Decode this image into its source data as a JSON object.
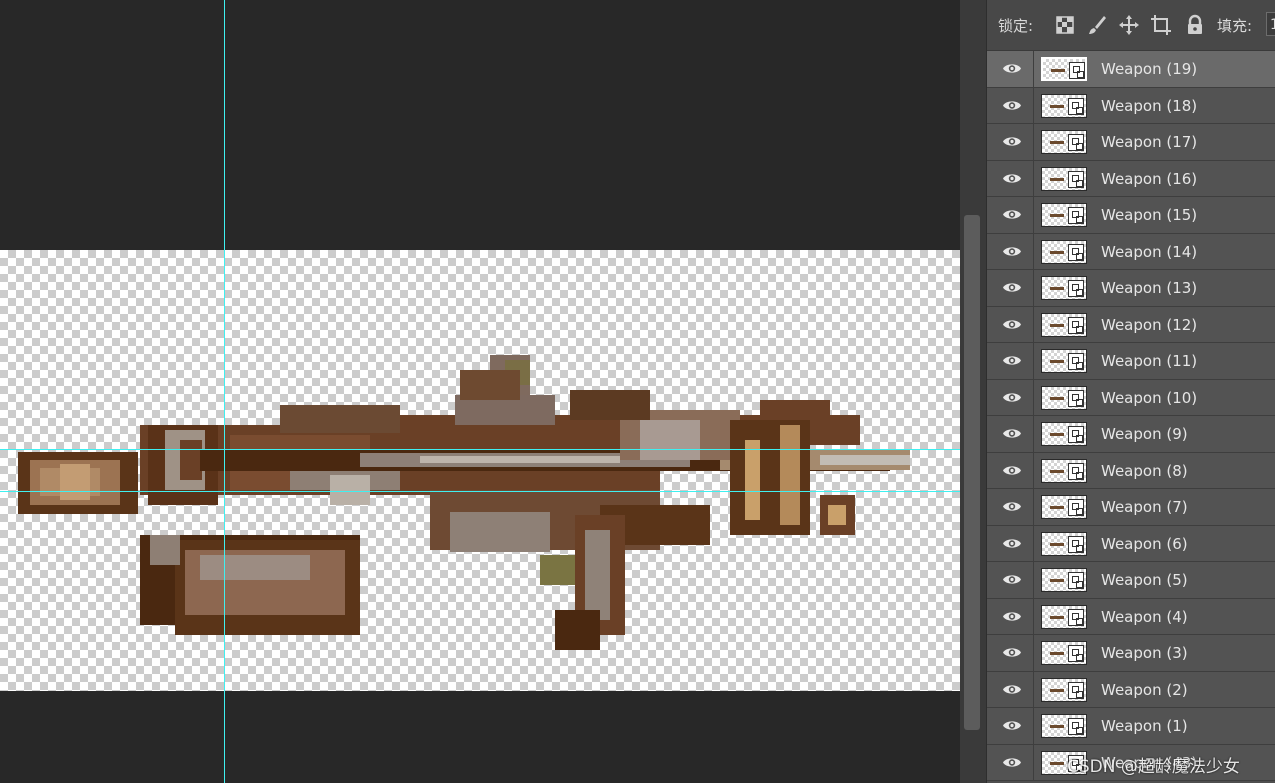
{
  "lock_bar": {
    "lock_label": "锁定:",
    "fill_label": "填充:",
    "fill_value": "1",
    "icons": [
      "lock-transparent-pixels-icon",
      "lock-image-pixels-icon",
      "lock-position-icon",
      "lock-artboard-icon",
      "lock-all-icon"
    ]
  },
  "layers": [
    {
      "name": "Weapon (19)",
      "selected": true
    },
    {
      "name": "Weapon (18)"
    },
    {
      "name": "Weapon (17)"
    },
    {
      "name": "Weapon (16)"
    },
    {
      "name": "Weapon (15)"
    },
    {
      "name": "Weapon (14)"
    },
    {
      "name": "Weapon (13)"
    },
    {
      "name": "Weapon (12)"
    },
    {
      "name": "Weapon (11)"
    },
    {
      "name": "Weapon (10)"
    },
    {
      "name": "Weapon (9)"
    },
    {
      "name": "Weapon (8)"
    },
    {
      "name": "Weapon (7)"
    },
    {
      "name": "Weapon (6)"
    },
    {
      "name": "Weapon (5)"
    },
    {
      "name": "Weapon (4)"
    },
    {
      "name": "Weapon (3)"
    },
    {
      "name": "Weapon (2)"
    },
    {
      "name": "Weapon (1)"
    },
    {
      "name": "Weapon (43)"
    }
  ],
  "watermark": "CSDN @超龄魔法少女",
  "colors": {
    "canvas_bg": "#282828",
    "guide": "#3ff0f0",
    "panel_bg": "#535353",
    "selected_row": "#6a6a6a"
  }
}
